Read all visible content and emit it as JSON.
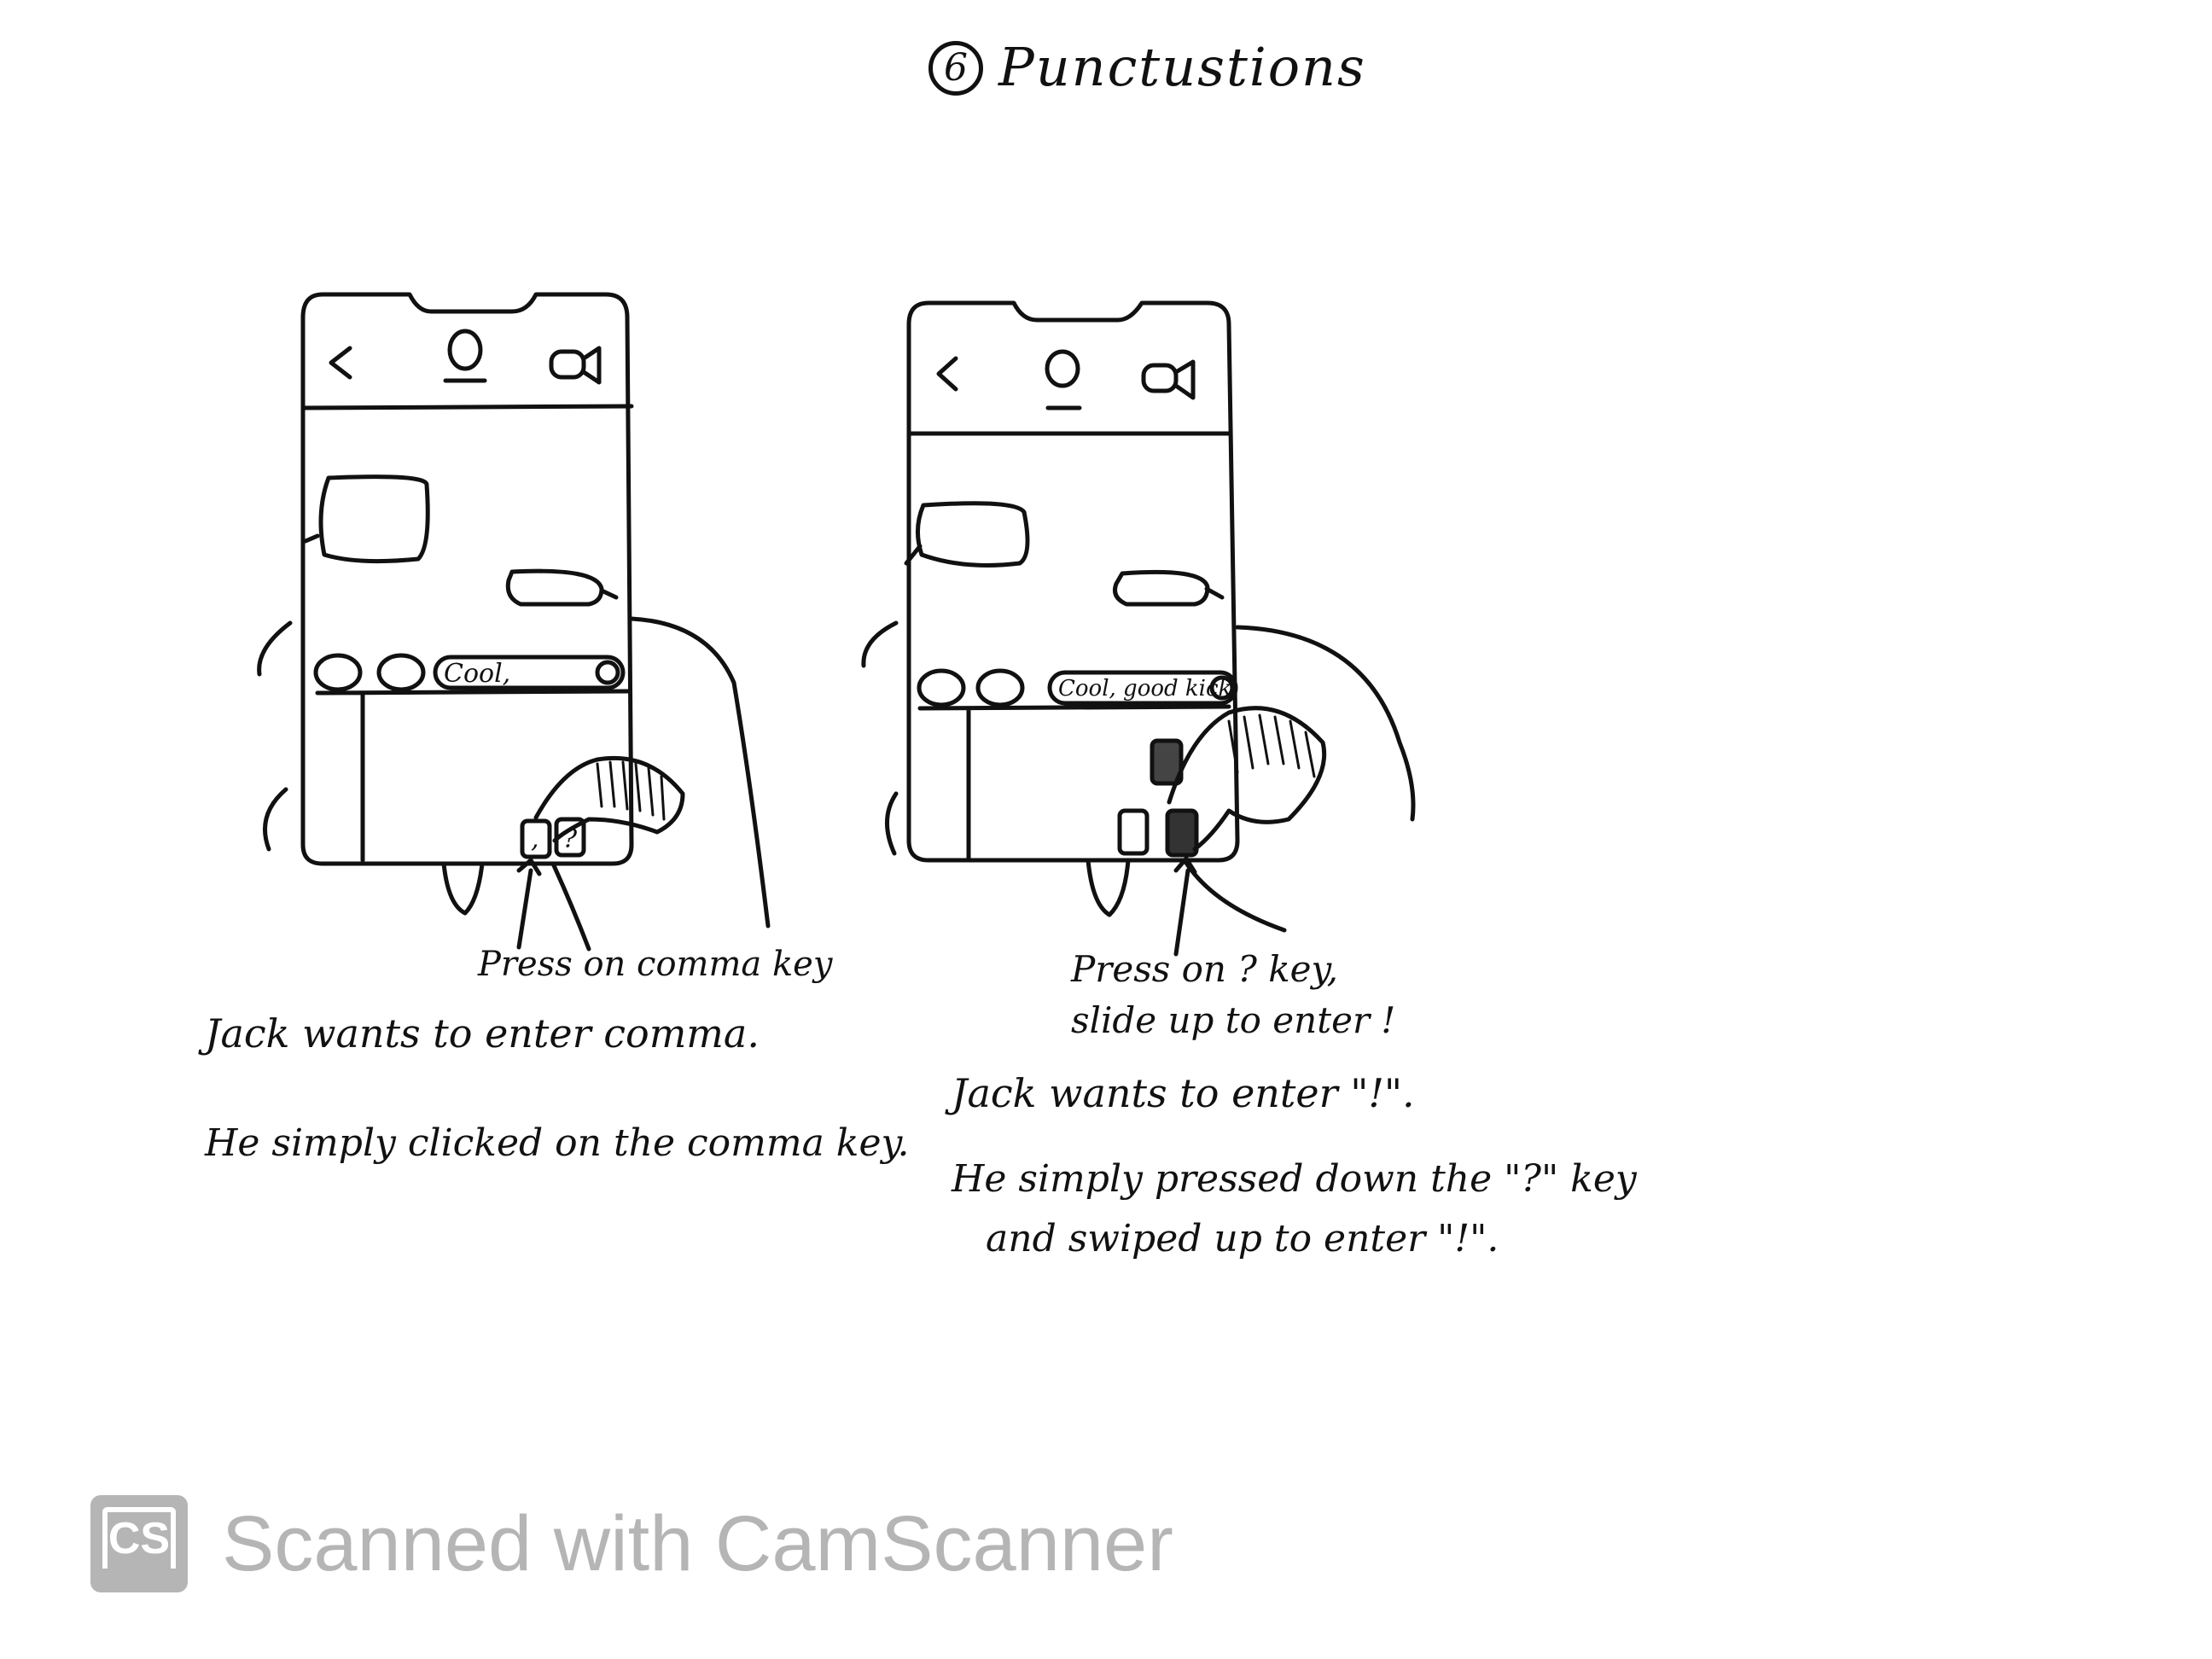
{
  "page": {
    "number": "6",
    "title": "Punctustions"
  },
  "panel_left": {
    "text_field": "Cool,",
    "key_left": ",",
    "key_right": "?",
    "annotation": "Press on comma key",
    "caption_line_1": "Jack wants to enter comma.",
    "caption_line_2": "He simply clicked on the comma key."
  },
  "panel_right": {
    "text_field": "Cool, good kick",
    "annotation_line_1": "Press on ? key,",
    "annotation_line_2": "slide up to enter !",
    "caption_line_1": "Jack wants to enter \"!\".",
    "caption_line_2": "He simply pressed down the \"?\" key",
    "caption_line_3": "and swiped up to enter \"!\"."
  },
  "watermark": {
    "logo_text": "CS",
    "text": "Scanned with CamScanner"
  },
  "colors": {
    "ink": "#111111",
    "watermark": "#b5b5b5",
    "paper": "#ffffff"
  }
}
